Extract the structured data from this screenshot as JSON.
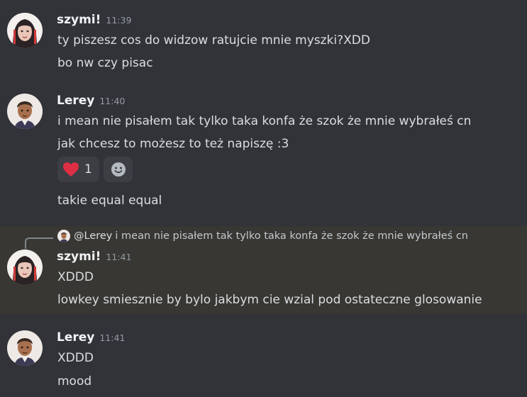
{
  "messages": {
    "g1": {
      "username": "szymi!",
      "time": "11:39",
      "lines": [
        "ty piszesz cos do widzow ratujcie mnie myszki?XDD",
        "bo nw czy pisac"
      ]
    },
    "g2": {
      "username": "Lerey",
      "time": "11:40",
      "lines": [
        "i mean nie pisałem tak tylko taka konfa że szok że mnie wybrałeś cn",
        "jak chcesz to możesz to też napiszę :3"
      ],
      "reactions": [
        {
          "emoji": "heart",
          "count": "1"
        },
        {
          "emoji": "add-reaction"
        }
      ],
      "after_reaction": "takie equal equal"
    },
    "g3": {
      "reply": {
        "user": "@Lerey",
        "text": "i mean nie pisałem tak tylko taka konfa że szok że mnie wybrałeś cn"
      },
      "username": "szymi!",
      "time": "11:41",
      "lines": [
        "XDDD",
        "lowkey smiesznie by bylo jakbym cie wzial pod ostateczne glosowanie"
      ]
    },
    "g4": {
      "username": "Lerey",
      "time": "11:41",
      "lines": [
        "XDDD",
        "mood"
      ]
    }
  },
  "colors": {
    "background": "#313338",
    "highlight": "#383733",
    "heart": "#dd2e44"
  }
}
